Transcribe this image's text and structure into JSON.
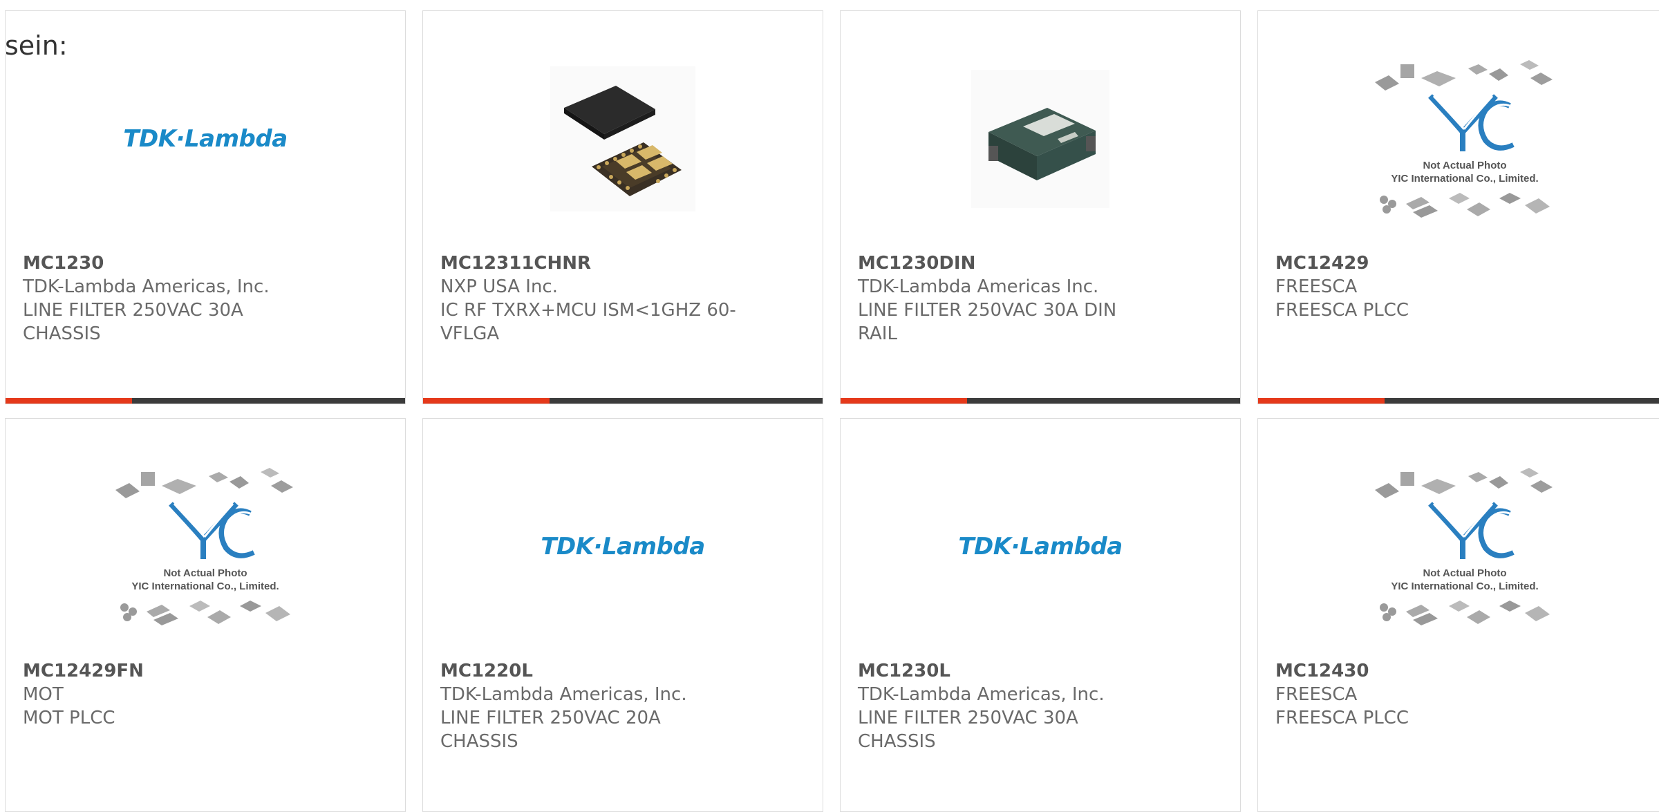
{
  "page": {
    "intro_text": "sein:"
  },
  "colors": {
    "accent": "#e5391a",
    "bar": "#3b3b3b",
    "tdk_blue": "#1a8ac8",
    "yic_blue": "#2a7fc0"
  },
  "products": [
    {
      "part": "MC1230",
      "manufacturer": "TDK-Lambda Americas, Inc.",
      "desc1": "LINE FILTER 250VAC 30A",
      "desc2": "CHASSIS",
      "image": "tdk-lambda-logo",
      "logo_text": "TDK·Lambda"
    },
    {
      "part": "MC12311CHNR",
      "manufacturer": "NXP USA Inc.",
      "desc1": "IC RF TXRX+MCU ISM<1GHZ 60-",
      "desc2": "VFLGA",
      "image": "chip-photo"
    },
    {
      "part": "MC1230DIN",
      "manufacturer": "TDK-Lambda Americas Inc.",
      "desc1": "LINE FILTER 250VAC 30A DIN",
      "desc2": "RAIL",
      "image": "filter-module-photo"
    },
    {
      "part": "MC12429",
      "manufacturer": "FREESCA",
      "desc1": "FREESCA PLCC",
      "desc2": "",
      "image": "not-actual-photo",
      "placeholder_line1": "Not Actual Photo",
      "placeholder_line2": "YIC International Co., Limited."
    },
    {
      "part": "MC12429FN",
      "manufacturer": "MOT",
      "desc1": "MOT PLCC",
      "desc2": "",
      "image": "not-actual-photo",
      "placeholder_line1": "Not Actual Photo",
      "placeholder_line2": "YIC International Co., Limited."
    },
    {
      "part": "MC1220L",
      "manufacturer": "TDK-Lambda Americas, Inc.",
      "desc1": "LINE FILTER 250VAC 20A",
      "desc2": "CHASSIS",
      "image": "tdk-lambda-logo",
      "logo_text": "TDK·Lambda"
    },
    {
      "part": "MC1230L",
      "manufacturer": "TDK-Lambda Americas, Inc.",
      "desc1": "LINE FILTER 250VAC 30A",
      "desc2": "CHASSIS",
      "image": "tdk-lambda-logo",
      "logo_text": "TDK·Lambda"
    },
    {
      "part": "MC12430",
      "manufacturer": "FREESCA",
      "desc1": "FREESCA PLCC",
      "desc2": "",
      "image": "not-actual-photo",
      "placeholder_line1": "Not Actual Photo",
      "placeholder_line2": "YIC International Co., Limited."
    }
  ]
}
